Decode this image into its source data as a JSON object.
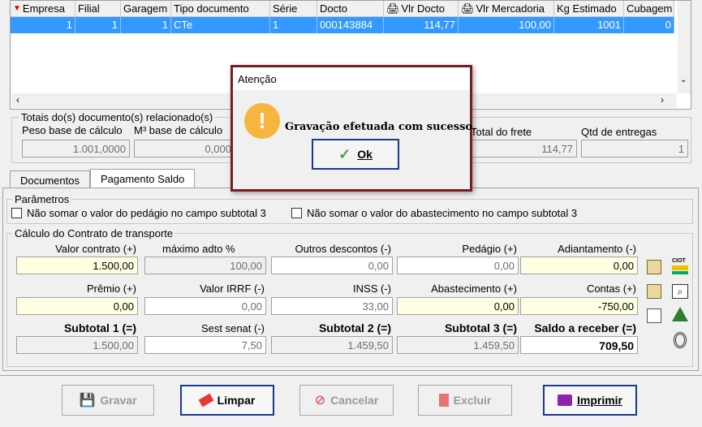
{
  "grid": {
    "columns": [
      "Empresa",
      "Filial",
      "Garagem",
      "Tipo documento",
      "Série",
      "Docto",
      "Vlr Docto",
      "Vlr Mercadoria",
      "Kg Estimado",
      "Cubagem"
    ],
    "row": [
      "1",
      "1",
      "1",
      "CTe",
      "1",
      "000143884",
      "114,77",
      "100,00",
      "1001",
      "0"
    ]
  },
  "totais": {
    "legend": "Totais do(s) documento(s) relacionado(s)",
    "peso_label": "Peso base de cálculo",
    "peso_value": "1.001,0000",
    "m3_label": "M³ base de cálculo",
    "m3_value": "0,000",
    "total_frete_label": "Total do frete",
    "total_frete_value": "114,77",
    "qtd_label": "Qtd de entregas",
    "qtd_value": "1"
  },
  "tabs": [
    "Documentos",
    "Pagamento Saldo"
  ],
  "parametros": {
    "legend": "Parâmetros",
    "check1": "Não somar o valor do pedágio no campo subtotal 3",
    "check2": "Não somar o valor do abastecimento no campo subtotal 3"
  },
  "calculo": {
    "legend": "Cálculo do Contrato de transporte",
    "valor_contrato_label": "Valor contrato (+)",
    "valor_contrato": "1.500,00",
    "max_adto_label": "máximo adto %",
    "max_adto": "100,00",
    "outros_label": "Outros descontos (-)",
    "outros": "0,00",
    "pedagio_label": "Pedágio (+)",
    "pedagio": "0,00",
    "adiantamento_label": "Adiantamento (-)",
    "adiantamento": "0,00",
    "premio_label": "Prêmio (+)",
    "premio": "0,00",
    "irrf_label": "Valor IRRF (-)",
    "irrf": "0,00",
    "inss_label": "INSS (-)",
    "inss": "33,00",
    "abastecimento_label": "Abastecimento (+)",
    "abastecimento": "0,00",
    "contas_label": "Contas (+)",
    "contas": "-750,00",
    "subtotal1_label": "Subtotal 1 (=)",
    "subtotal1": "1.500,00",
    "sest_label": "Sest senat (-)",
    "sest": "7,50",
    "subtotal2_label": "Subtotal 2 (=)",
    "subtotal2": "1.459,50",
    "subtotal3_label": "Subtotal 3 (=)",
    "subtotal3": "1.459,50",
    "saldo_label": "Saldo a receber (=)",
    "saldo": "709,50",
    "ciot_text": "CIOT"
  },
  "footer": {
    "gravar": "Gravar",
    "limpar": "Limpar",
    "cancelar": "Cancelar",
    "excluir": "Excluir",
    "imprimir": "Imprimir"
  },
  "dialog": {
    "title": "Atenção",
    "message": "Gravação efetuada com sucesso.",
    "ok": "Ok"
  }
}
